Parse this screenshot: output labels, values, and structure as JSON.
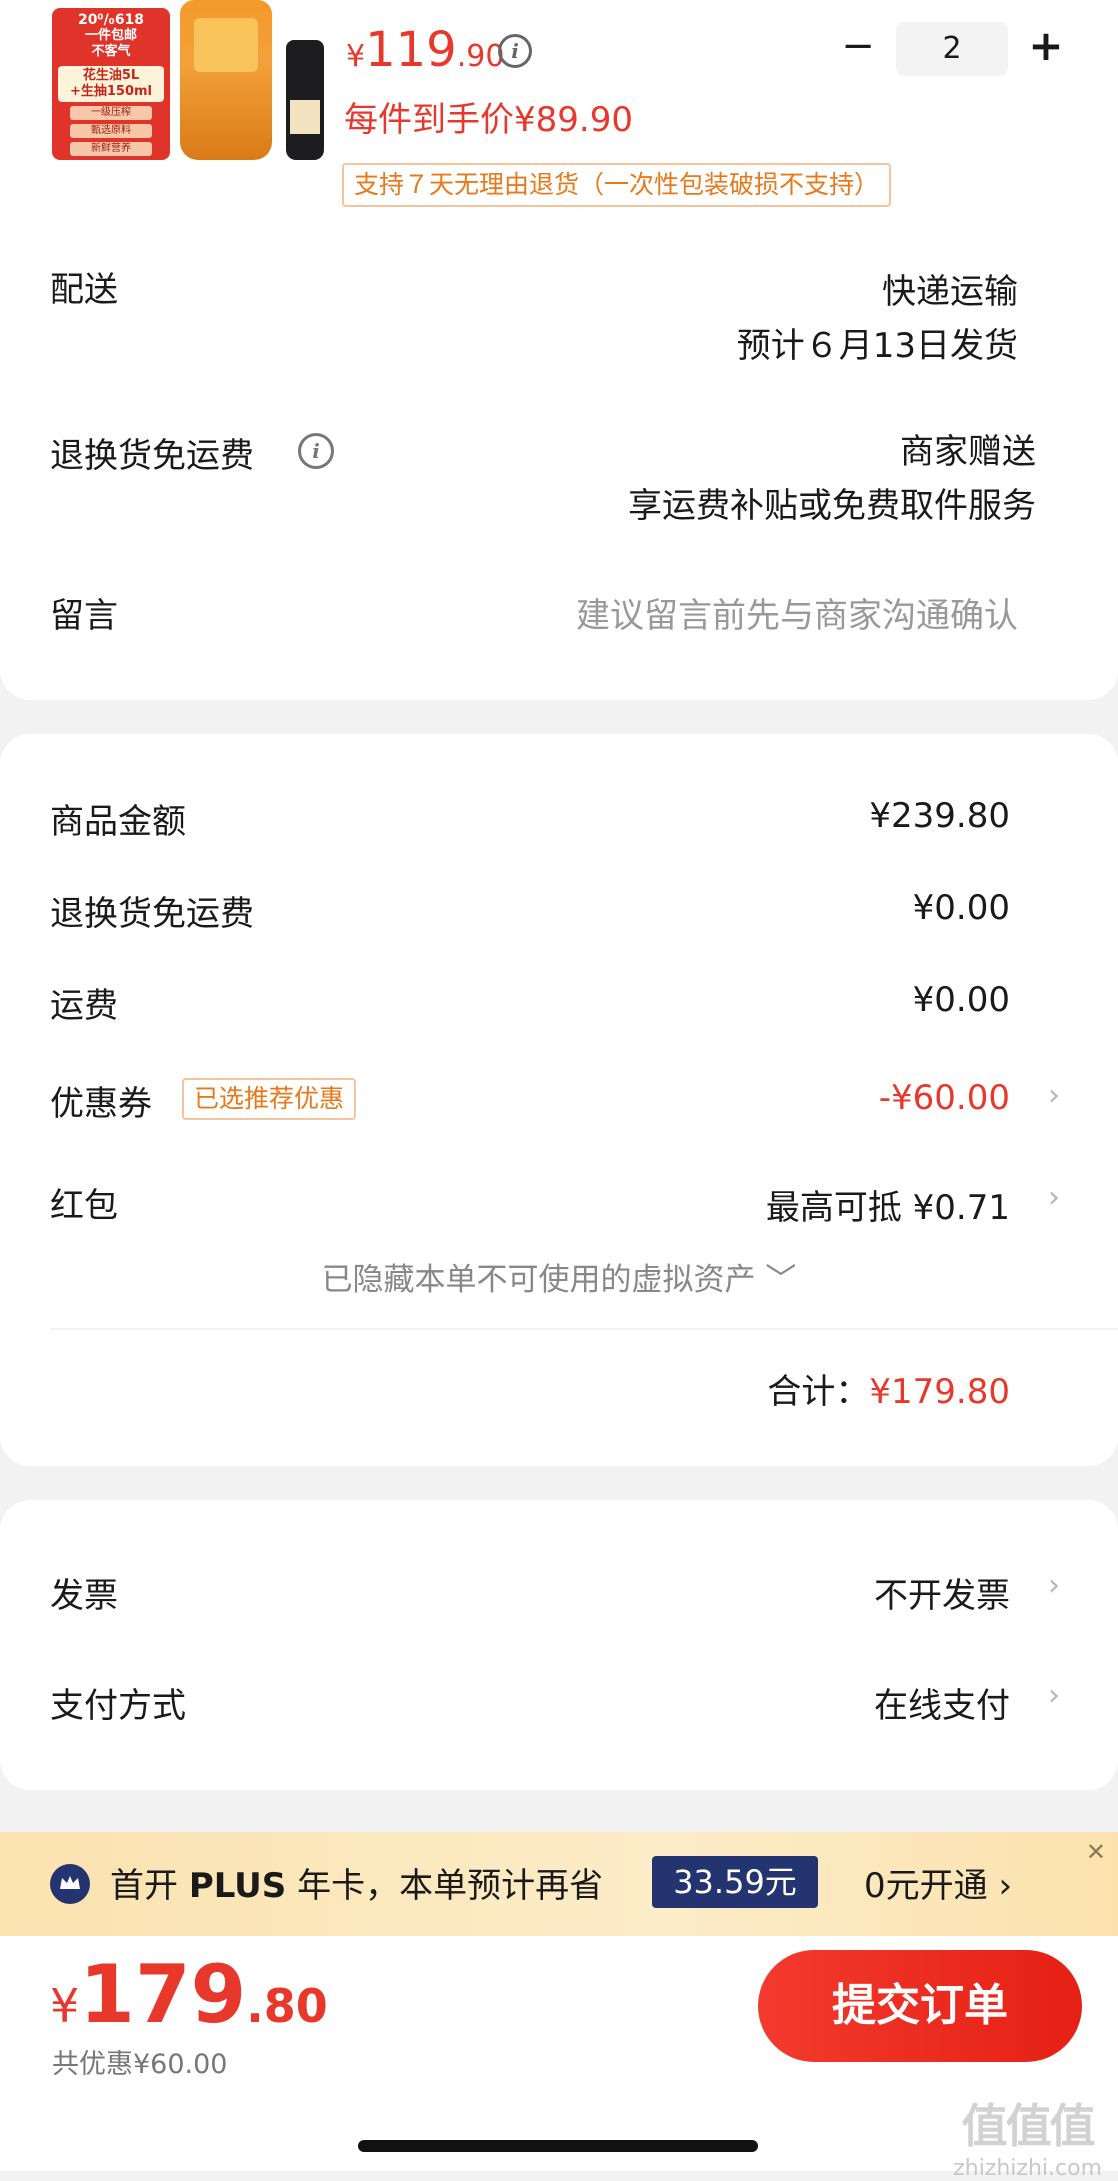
{
  "product": {
    "image_lines": [
      "20⁰/₀618",
      "一件包邮",
      "不客气",
      "花生油5L",
      "+生抽150ml",
      "一级压榨",
      "甄选原料",
      "新鲜营养"
    ],
    "price_symbol": "¥",
    "price_int": "119",
    "price_dec": ".90",
    "quantity": "2",
    "each_price": "每件到手价¥89.90",
    "return_policy": "支持７天无理由退货（一次性包装破损不支持）"
  },
  "delivery": {
    "label": "配送",
    "method": "快递运输",
    "eta": "预计６月13日发货"
  },
  "return_shipping": {
    "label": "退换货免运费",
    "value": "商家赠送",
    "desc": "享运费补贴或免费取件服务"
  },
  "message": {
    "label": "留言",
    "placeholder": "建议留言前先与商家沟通确认"
  },
  "summary": {
    "goods_label": "商品金额",
    "goods_value": "¥239.80",
    "return_label": "退换货免运费",
    "return_value": "¥0.00",
    "shipping_label": "运费",
    "shipping_value": "¥0.00",
    "coupon_label": "优惠券",
    "coupon_tag": "已选推荐优惠",
    "coupon_value": "-¥60.00",
    "redpacket_label": "红包",
    "redpacket_value": "最高可抵 ¥0.71",
    "hidden_assets": "已隐藏本单不可使用的虚拟资产 ﹀",
    "total_label": "合计：",
    "total_value": "¥179.80"
  },
  "invoice": {
    "label": "发票",
    "value": "不开发票"
  },
  "payment": {
    "label": "支付方式",
    "value": "在线支付"
  },
  "plus": {
    "text_prefix": "首开",
    "text_plus": "PLUS",
    "text_suffix": "年卡，本单预计再省",
    "amount": "33.59元",
    "action": "0元开通 ›",
    "close": "✕"
  },
  "bottom": {
    "symbol": "¥",
    "total_int": "179",
    "total_dec": ".80",
    "discount": "共优惠¥60.00",
    "submit": "提交订单"
  },
  "watermark": {
    "glyphs": "值值值",
    "domain": "zhizhizhi.com"
  },
  "colors": {
    "accent": "#e8372b",
    "plus_navy": "#243470",
    "tag_orange": "#e8791b"
  }
}
